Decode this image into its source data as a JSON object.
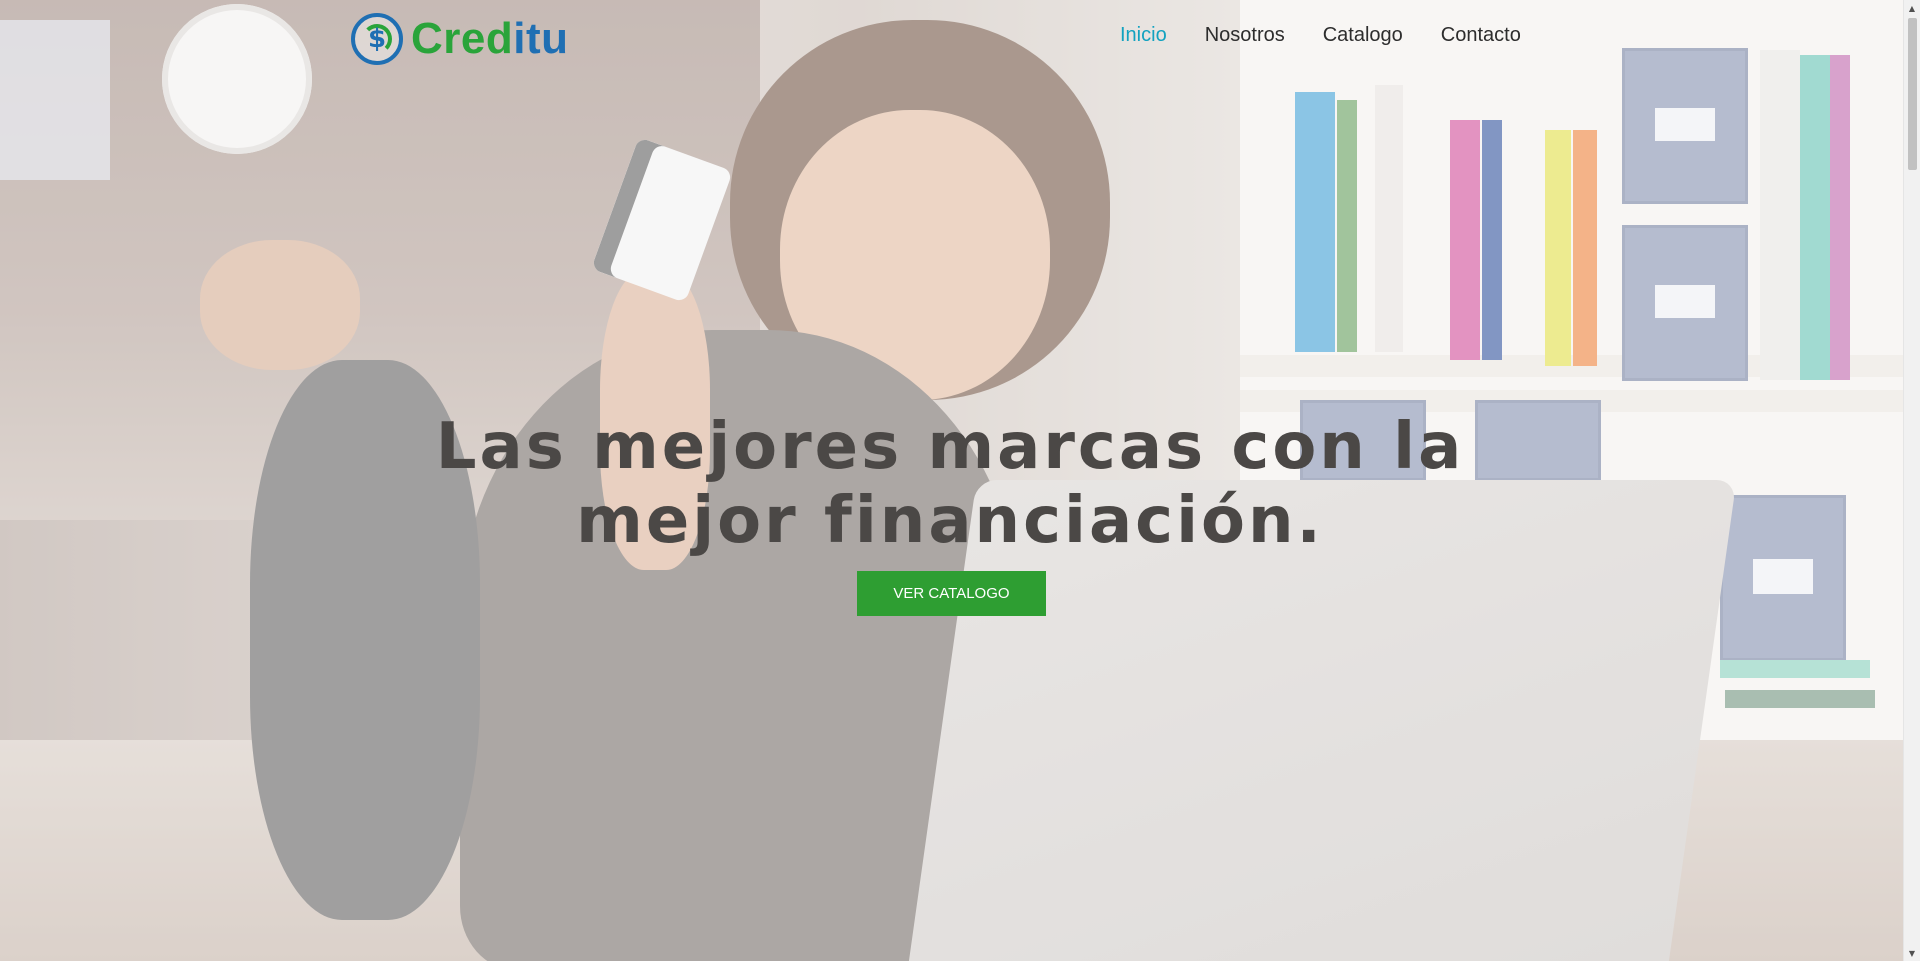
{
  "brand": {
    "logo_symbol": "$",
    "name_part1": "Cred",
    "name_part2": "itu",
    "colors": {
      "green": "#2aa43a",
      "blue": "#1f6fb3"
    }
  },
  "nav": {
    "items": [
      {
        "label": "Inicio",
        "active": true
      },
      {
        "label": "Nosotros",
        "active": false
      },
      {
        "label": "Catalogo",
        "active": false
      },
      {
        "label": "Contacto",
        "active": false
      }
    ],
    "active_color": "#13a2c0"
  },
  "hero": {
    "headline": "Las mejores marcas con la mejor financiación.",
    "cta_label": "VER CATALOGO",
    "cta_color": "#2e9e32"
  },
  "scrollbar": {
    "up_icon": "chevron-up-icon",
    "down_icon": "chevron-down-icon"
  }
}
